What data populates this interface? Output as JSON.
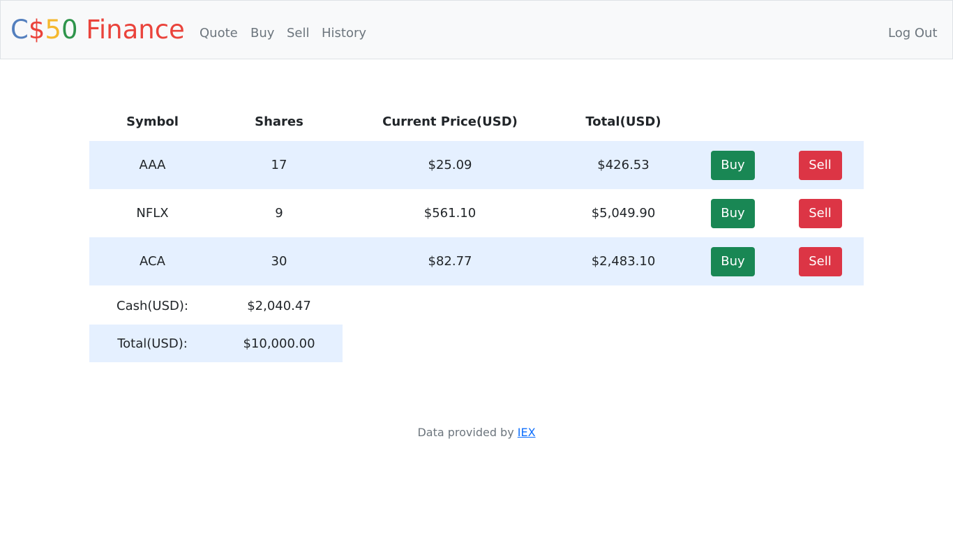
{
  "navbar": {
    "brand": {
      "c": "C",
      "dollar": "$",
      "five": "5",
      "zero": "0",
      "finance": " Finance"
    },
    "links": [
      "Quote",
      "Buy",
      "Sell",
      "History"
    ],
    "logout": "Log Out"
  },
  "table": {
    "headers": [
      "Symbol",
      "Shares",
      "Current Price(USD)",
      "Total(USD)"
    ],
    "rows": [
      {
        "symbol": "AAA",
        "shares": "17",
        "price": "$25.09",
        "total": "$426.53",
        "buy": "Buy",
        "sell": "Sell"
      },
      {
        "symbol": "NFLX",
        "shares": "9",
        "price": "$561.10",
        "total": "$5,049.90",
        "buy": "Buy",
        "sell": "Sell"
      },
      {
        "symbol": "ACA",
        "shares": "30",
        "price": "$82.77",
        "total": "$2,483.10",
        "buy": "Buy",
        "sell": "Sell"
      }
    ]
  },
  "summary": {
    "cash_label": "Cash(USD):",
    "cash_value": "$2,040.47",
    "total_label": "Total(USD):",
    "total_value": "$10,000.00"
  },
  "footer": {
    "text": "Data provided by ",
    "link": "IEX"
  },
  "colors": {
    "brand_blue": "#537fbe",
    "brand_red": "#ea433b",
    "brand_yellow": "#f5b82e",
    "brand_green": "#2e944b",
    "buy_button": "#198754",
    "sell_button": "#dc3545",
    "stripe": "#e5f0ff",
    "link": "#0d6efd"
  }
}
